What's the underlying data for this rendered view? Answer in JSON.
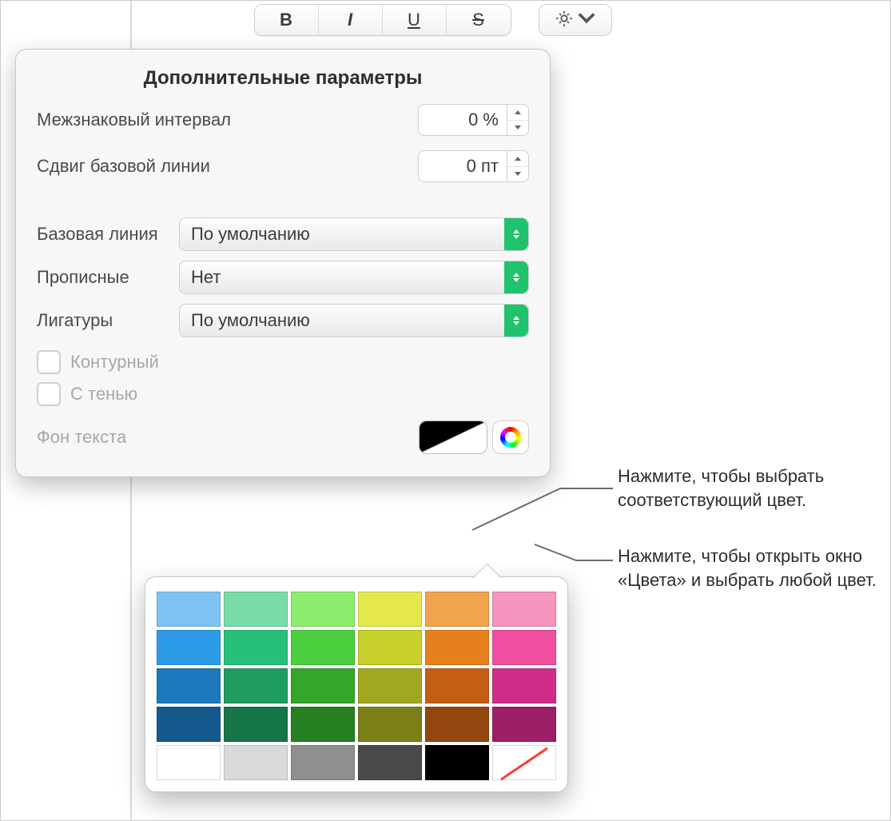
{
  "toolbar": {
    "bold": "B",
    "italic": "I",
    "underline": "U",
    "strike": "S"
  },
  "title": "Дополнительные параметры",
  "tracking": {
    "label": "Межзнаковый интервал",
    "value": "0 %"
  },
  "baseline_shift": {
    "label": "Сдвиг базовой линии",
    "value": "0 пт"
  },
  "baseline": {
    "label": "Базовая линия",
    "value": "По умолчанию"
  },
  "caps": {
    "label": "Прописные",
    "value": "Нет"
  },
  "ligatures": {
    "label": "Лигатуры",
    "value": "По умолчанию"
  },
  "outline": "Контурный",
  "shadow": "С тенью",
  "textbg": "Фон текста",
  "callout1": "Нажмите, чтобы выбрать соответствующий цвет.",
  "callout2": "Нажмите, чтобы открыть окно «Цвета» и выбрать любой цвет.",
  "swatches": [
    [
      "#7fc3f2",
      "#77dca8",
      "#8ded6f",
      "#e4e84b",
      "#f2a34d",
      "#f695be"
    ],
    [
      "#2d9ce8",
      "#27c07a",
      "#4bcf3f",
      "#c8d12c",
      "#e6801f",
      "#ef4fa0"
    ],
    [
      "#1d78bd",
      "#1f9d60",
      "#33a62c",
      "#a1a820",
      "#c55e14",
      "#cf2d88"
    ],
    [
      "#155a8f",
      "#177649",
      "#267f20",
      "#7a7f17",
      "#93460e",
      "#9d1f65"
    ],
    [
      "#ffffff",
      "#d9d9d9",
      "#8f8f8f",
      "#4a4a4a",
      "#000000",
      "none"
    ]
  ]
}
